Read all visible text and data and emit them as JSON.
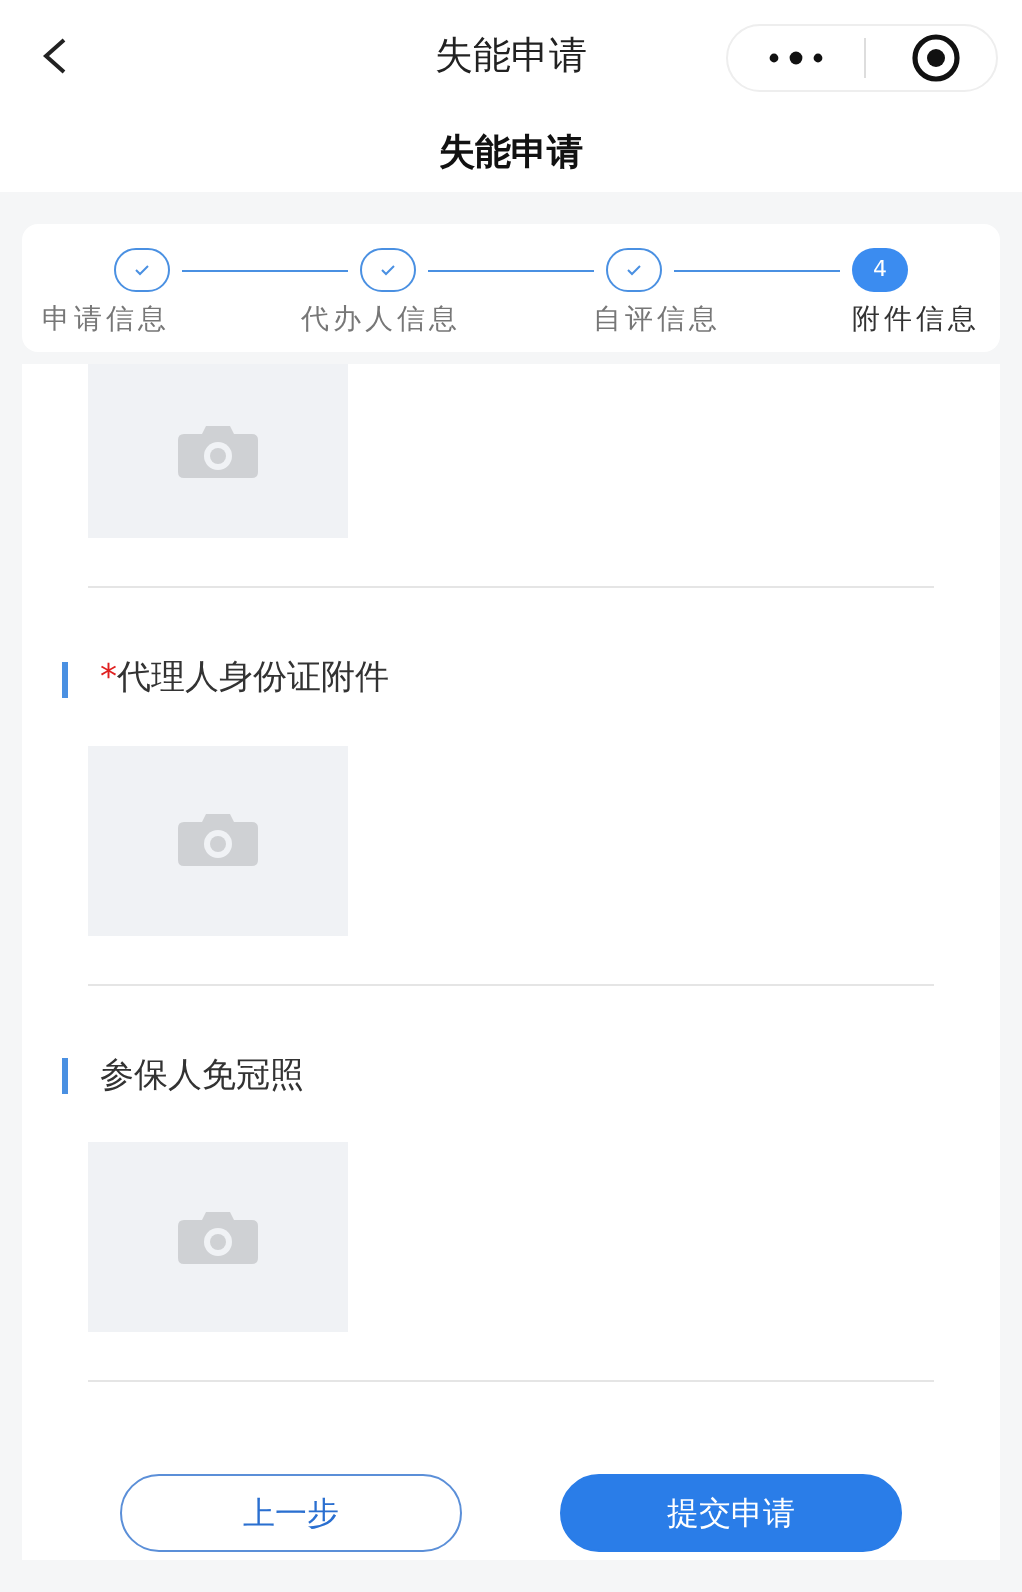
{
  "nav_bar": {
    "title": "失能申请"
  },
  "page_title": "失能申请",
  "steps": [
    {
      "label": "申请信息",
      "done": true,
      "selected": false
    },
    {
      "label": "代办人信息",
      "done": true,
      "selected": false
    },
    {
      "label": "自评信息",
      "done": true,
      "selected": false
    },
    {
      "label": "附件信息",
      "done": false,
      "selected": true,
      "number": "4"
    }
  ],
  "sections": [
    {
      "kind": "cut_off"
    },
    {
      "kind": "upload",
      "title": "代理人身份证附件",
      "required_mark": "*"
    },
    {
      "kind": "upload",
      "title": "参保人免冠照"
    }
  ],
  "buttons": [
    {
      "label": "上一步",
      "kind": "secondary"
    },
    {
      "label": "提交申请",
      "kind": "primary"
    }
  ]
}
